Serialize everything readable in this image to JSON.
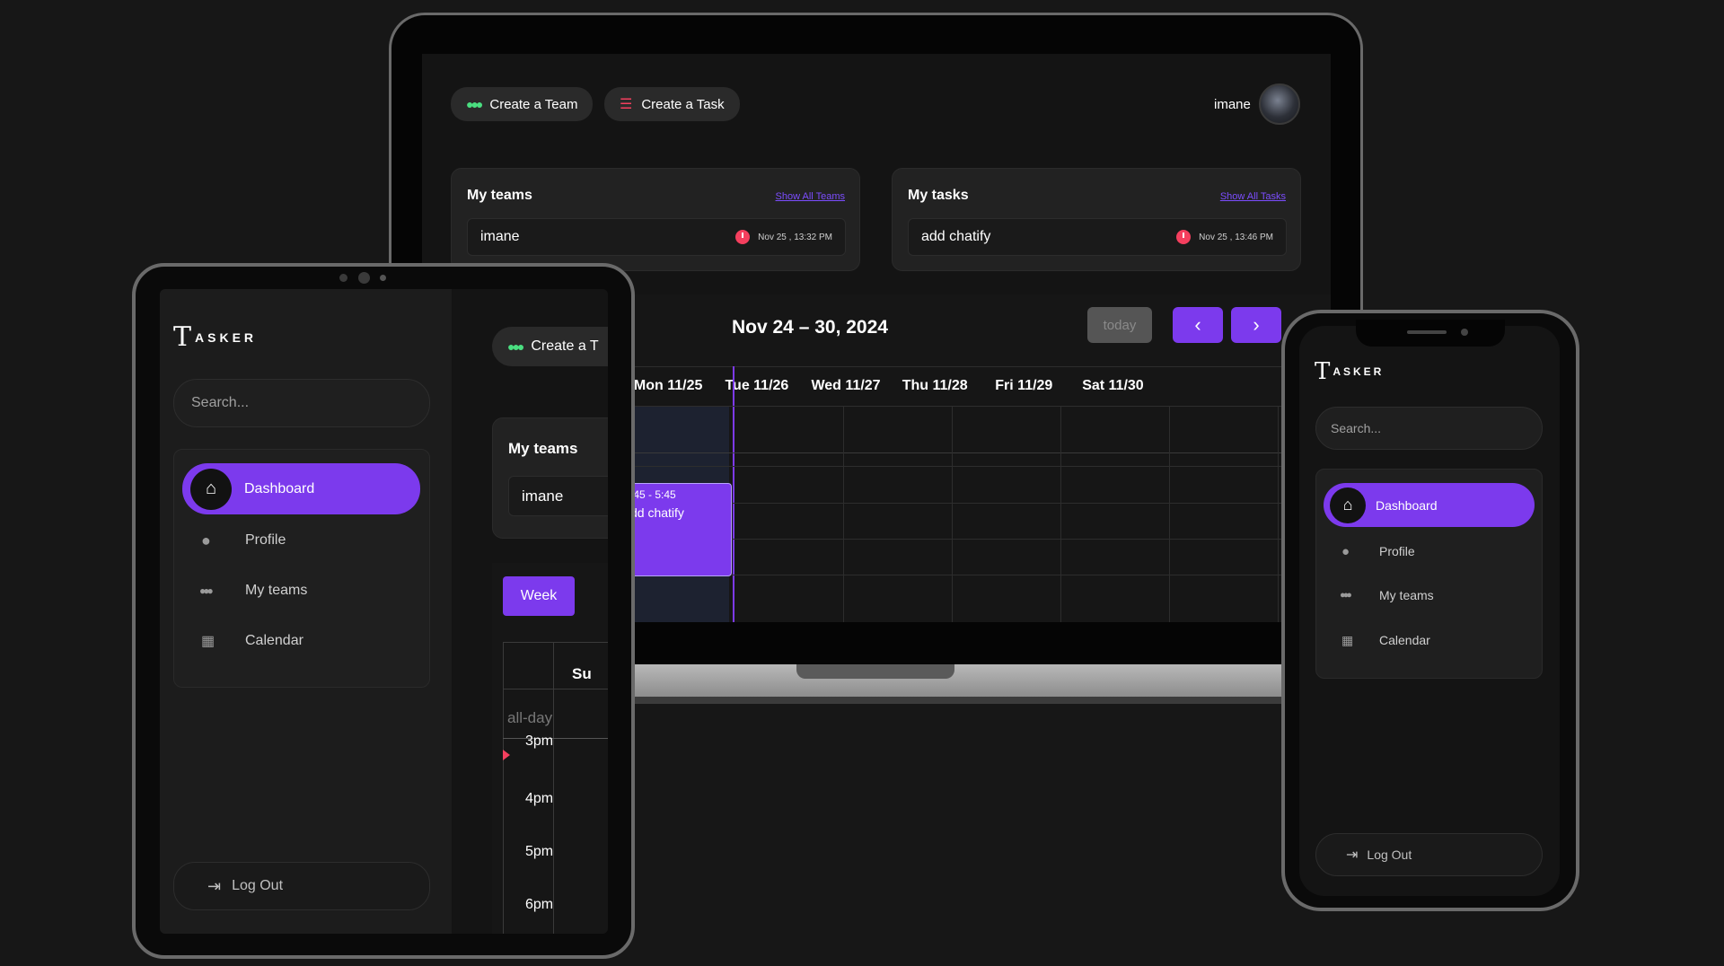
{
  "laptop": {
    "create_team": "Create a Team",
    "create_task": "Create a Task",
    "user_name": "imane",
    "teams_card": {
      "title": "My teams",
      "link": "Show All Teams",
      "row_name": "imane",
      "row_date": "Nov 25 , 13:32 PM"
    },
    "tasks_card": {
      "title": "My tasks",
      "link": "Show All Tasks",
      "row_name": "add chatify",
      "row_date": "Nov 25 , 13:46 PM"
    },
    "calendar": {
      "range_title": "Nov 24 – 30, 2024",
      "today_label": "today",
      "prev_icon": "‹",
      "next_icon": "›",
      "days": [
        "Mon 11/25",
        "Tue 11/26",
        "Wed 11/27",
        "Thu 11/28",
        "Fri 11/29",
        "Sat 11/30"
      ],
      "event_time": ":45 - 5:45",
      "event_title": "dd chatify"
    }
  },
  "tablet": {
    "logo_letter": "T",
    "logo_text": "ASKER",
    "search_placeholder": "Search...",
    "nav": [
      "Dashboard",
      "Profile",
      "My teams",
      "Calendar"
    ],
    "logout": "Log Out",
    "create_team_partial": "Create a T",
    "teams_title": "My teams",
    "team_row": "imane",
    "week_label": "Week",
    "col_header_partial": "Su",
    "allday": "all-day",
    "times": [
      "3pm",
      "4pm",
      "5pm",
      "6pm"
    ]
  },
  "phone": {
    "logo_letter": "T",
    "logo_text": "ASKER",
    "search_placeholder": "Search...",
    "nav": [
      "Dashboard",
      "Profile",
      "My teams",
      "Calendar"
    ],
    "logout": "Log Out"
  },
  "colors": {
    "accent": "#7c3aed",
    "team_icon": "#4ade80",
    "task_icon": "#f43f5e",
    "background": "#171717"
  }
}
